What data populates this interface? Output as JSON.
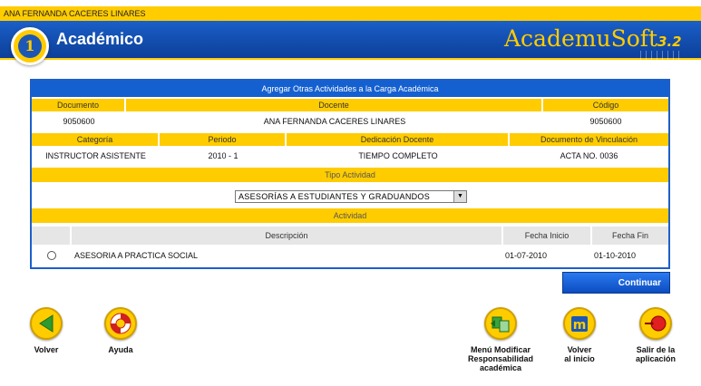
{
  "user": {
    "name": "ANA FERNANDA CACERES LINARES"
  },
  "header": {
    "section_title": "Académico",
    "brand": "AcademuSoft",
    "version": "3.2",
    "logo_glyph": "1"
  },
  "panel": {
    "title": "Agregar Otras Actividades a la Carga Académica",
    "row1_headers": [
      "Documento",
      "Docente",
      "Código"
    ],
    "row1_values": [
      "9050600",
      "ANA FERNANDA CACERES LINARES",
      "9050600"
    ],
    "row2_headers": [
      "Categoría",
      "Periodo",
      "Dedicación Docente",
      "Documento de Vinculación"
    ],
    "row2_values": [
      "INSTRUCTOR ASISTENTE",
      "2010 - 1",
      "TIEMPO COMPLETO",
      "ACTA NO. 0036"
    ],
    "tipo_actividad_label": "Tipo Actividad",
    "tipo_actividad_selected": "ASESORÍAS A ESTUDIANTES Y GRADUANDOS",
    "actividad_label": "Actividad",
    "activity_headers": [
      "Descripción",
      "Fecha Inicio",
      "Fecha Fin"
    ],
    "activities": [
      {
        "descripcion": "ASESORIA A PRACTICA SOCIAL",
        "fecha_inicio": "01-07-2010",
        "fecha_fin": "01-10-2010"
      }
    ]
  },
  "actions": {
    "continuar": "Continuar"
  },
  "nav": {
    "volver": "Volver",
    "ayuda": "Ayuda",
    "menu_modificar": [
      "Menú Modificar",
      "Responsabilidad",
      "académica"
    ],
    "volver_inicio": [
      "Volver",
      "al inicio"
    ],
    "salir": [
      "Salir de la",
      "aplicación"
    ]
  },
  "colors": {
    "yellow": "#ffcc00",
    "blue": "#1460d0",
    "green": "#3aa53a",
    "red": "#e02020"
  }
}
